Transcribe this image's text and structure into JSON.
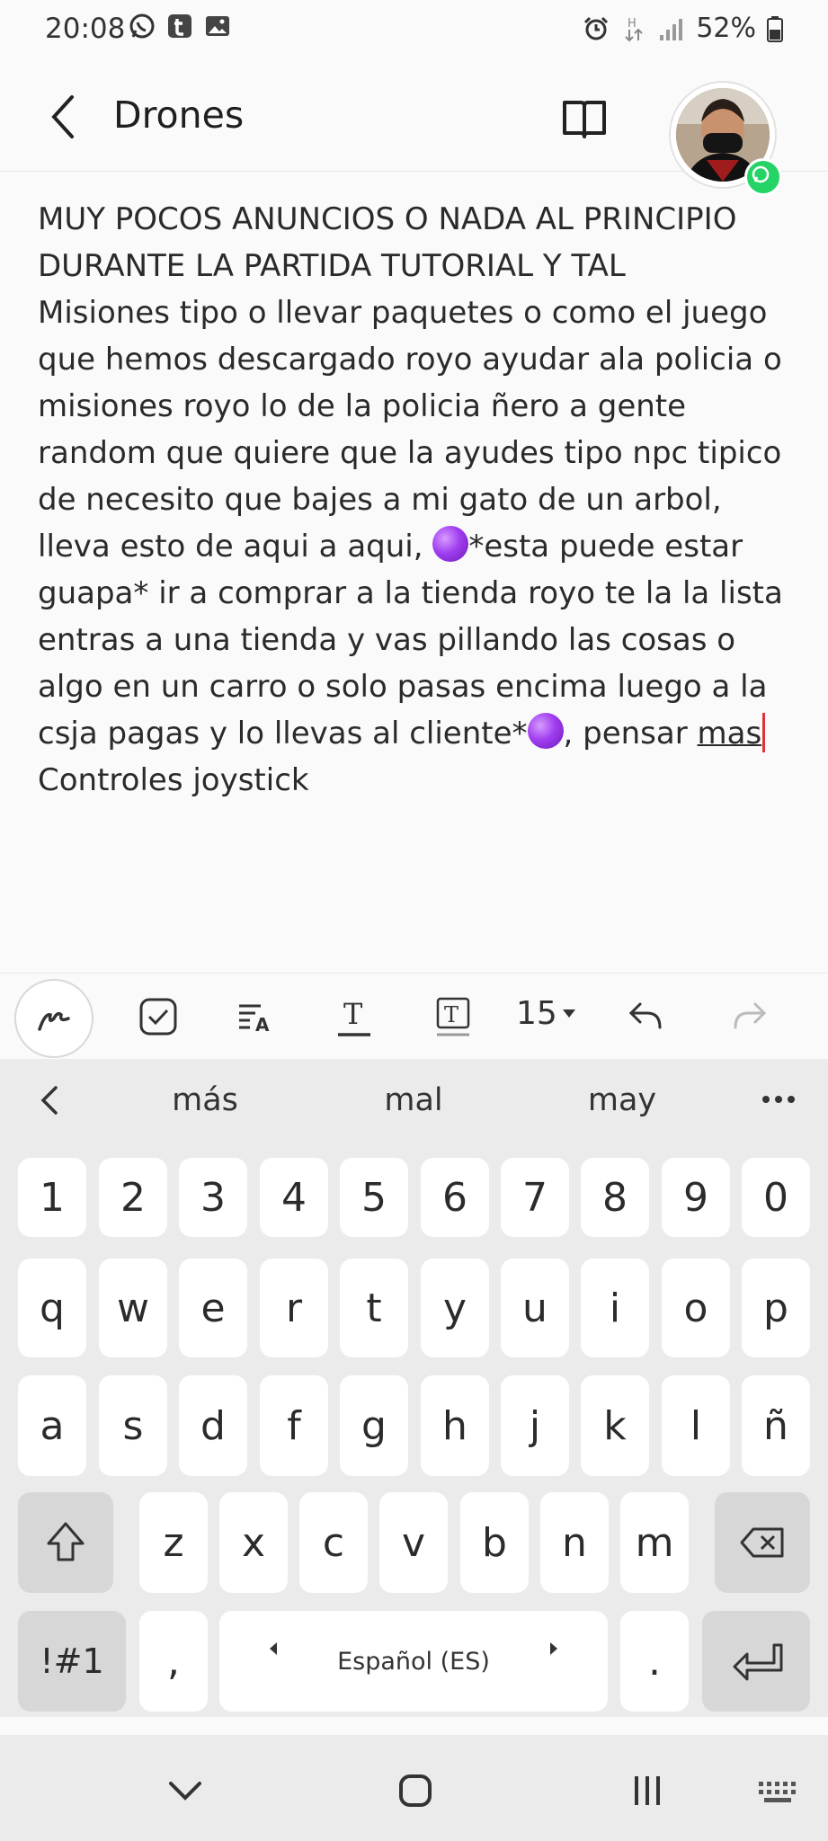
{
  "status_bar": {
    "time": "20:08",
    "left_icons": [
      "whatsapp-icon",
      "tumblr-icon",
      "gallery-icon"
    ],
    "right_icons": [
      "alarm-icon",
      "data-transfer-icon",
      "signal-icon"
    ],
    "battery_text": "52%"
  },
  "app_bar": {
    "title": "Drones",
    "back_icon": "chevron-left-icon",
    "reader_icon": "book-open-icon"
  },
  "note": {
    "lines": [
      "MUY POCOS ANUNCIOS O NADA AL PRINCIPIO",
      "DURANTE LA PARTIDA TUTORIAL Y TAL",
      "Misiones tipo o llevar paquetes o como el juego",
      "que hemos descargado royo ayudar ala policia o",
      "misiones royo lo de la policia ñero a gente",
      "random que quiere que la ayudes tipo npc tipico",
      "de necesito que bajes a mi gato de un arbol,"
    ],
    "line8_before": "lleva esto de aqui a aqui, ",
    "line8_after": "*esta puede estar",
    "lines_mid": [
      "guapa* ir a comprar a la tienda royo te la la lista",
      "entras a una tienda y vas pillando las cosas o",
      "algo en un carro o solo pasas encima luego a la"
    ],
    "line12_before": "csja pagas y lo llevas al cliente*",
    "line12_after": ", pensar ",
    "cursor_word": "mas",
    "last_line": "Controles joystick",
    "emoji_color": "#a03ef0"
  },
  "toolbar": {
    "font_size": "15"
  },
  "suggestions": [
    "más",
    "mal",
    "may"
  ],
  "keyboard": {
    "row_numbers": [
      "1",
      "2",
      "3",
      "4",
      "5",
      "6",
      "7",
      "8",
      "9",
      "0"
    ],
    "row1": [
      "q",
      "w",
      "e",
      "r",
      "t",
      "y",
      "u",
      "i",
      "o",
      "p"
    ],
    "row2": [
      "a",
      "s",
      "d",
      "f",
      "g",
      "h",
      "j",
      "k",
      "l",
      "ñ"
    ],
    "row3": [
      "z",
      "x",
      "c",
      "v",
      "b",
      "n",
      "m"
    ],
    "symbols_label": "!#1",
    "comma": ",",
    "space_label": "Español (ES)",
    "period": "."
  }
}
